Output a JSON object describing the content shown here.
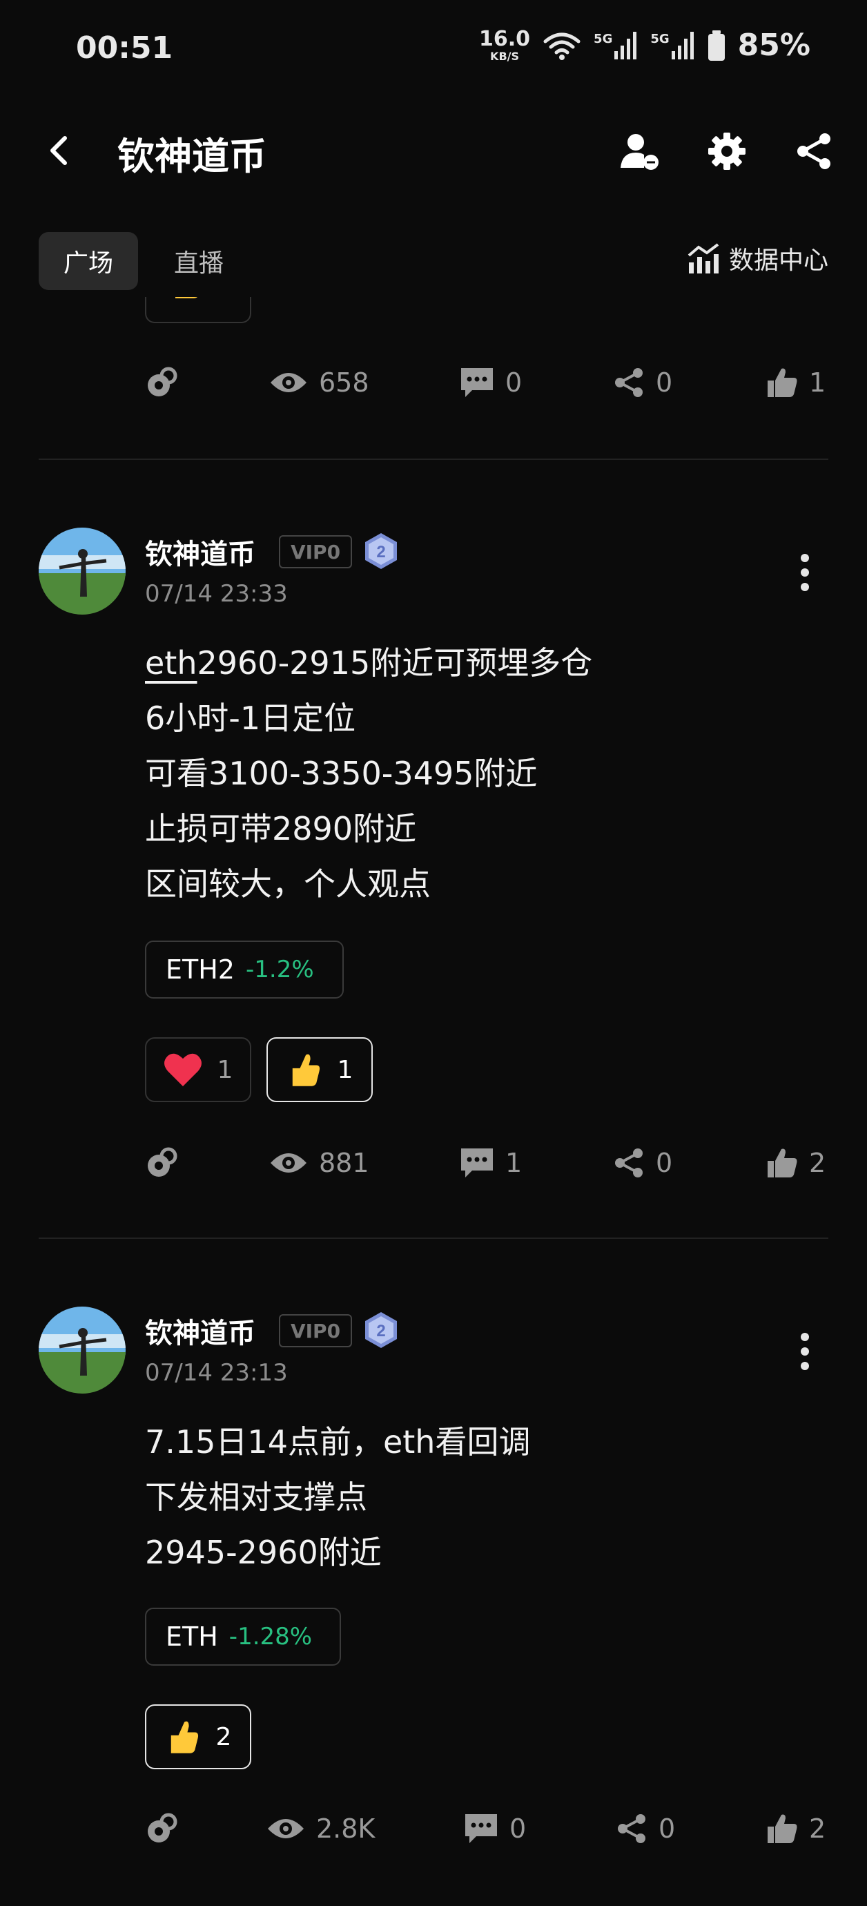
{
  "status_bar": {
    "time": "00:51",
    "net_speed_value": "16.0",
    "net_speed_unit": "KB/S",
    "signal1": "5G",
    "signal2": "5G",
    "battery": "85%"
  },
  "header": {
    "title": "钦神道币",
    "icons": [
      "back-icon",
      "user-icon",
      "gear-icon",
      "share-icon"
    ]
  },
  "tabs": {
    "items": [
      {
        "label": "广场",
        "active": true
      },
      {
        "label": "直播",
        "active": false
      }
    ],
    "data_center": "数据中心"
  },
  "top_stats": {
    "views": "658",
    "comments": "0",
    "shares": "0",
    "likes": "1"
  },
  "posts": [
    {
      "author": "钦神道币",
      "vip": "VIP0",
      "level": "2",
      "time": "07/14 23:33",
      "lines": [
        "eth2960-2915附近可预埋多仓",
        "6小时-1日定位",
        "可看3100-3350-3495附近",
        "止损可带2890附近",
        "区间较大，个人观点"
      ],
      "line0_tag": "eth",
      "line0_rest": "2960-2915附近可预埋多仓",
      "ticker": {
        "symbol": "ETH2",
        "change": "-1.2%"
      },
      "reactions": [
        {
          "emoji": "heart",
          "count": "1",
          "active": false
        },
        {
          "emoji": "thumbs-up",
          "count": "1",
          "active": true
        }
      ],
      "stats": {
        "views": "881",
        "comments": "1",
        "shares": "0",
        "likes": "2"
      }
    },
    {
      "author": "钦神道币",
      "vip": "VIP0",
      "level": "2",
      "time": "07/14 23:13",
      "lines": [
        "7.15日14点前，eth看回调",
        "下发相对支撑点",
        "2945-2960附近"
      ],
      "ticker": {
        "symbol": "ETH",
        "change": "-1.28%"
      },
      "reactions": [
        {
          "emoji": "thumbs-up",
          "count": "2",
          "active": true
        }
      ],
      "stats": {
        "views": "2.8K",
        "comments": "0",
        "shares": "0",
        "likes": "2"
      }
    }
  ],
  "colors": {
    "background": "#0b0b0b",
    "positive_green": "#28c081",
    "muted_text": "#9a9a9a",
    "heart_red": "#f0324f",
    "thumb_yellow": "#ffc93a"
  }
}
